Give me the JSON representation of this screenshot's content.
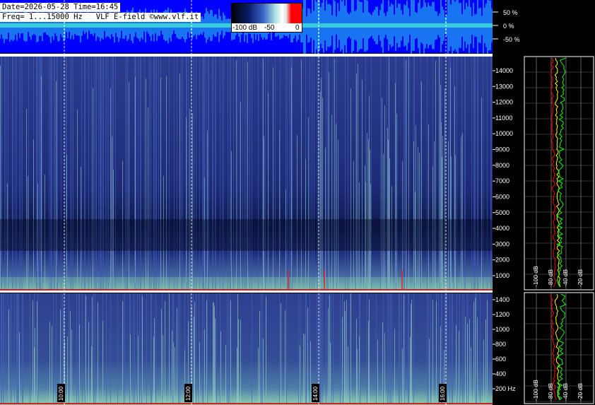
{
  "header": {
    "line1": "Date=2026-05-28 Time=16:45",
    "line2": "Freq= 1...15000 Hz   VLF E-field ©www.vlf.it"
  },
  "colorbar": {
    "labels": [
      "-100 dB",
      "-50",
      "0"
    ],
    "colors": [
      "#000000",
      "#0a1f6e",
      "#3a64c8",
      "#a8e0e0",
      "#ffffff",
      "#ff0000"
    ]
  },
  "chart_data": [
    {
      "type": "area",
      "name": "waveform-amplitude",
      "yaxis_ticks": [
        "50 %",
        "0 %",
        "-50 %"
      ],
      "ylim": [
        -100,
        100
      ]
    },
    {
      "type": "heatmap",
      "name": "spectrogram-wide",
      "yaxis_ticks": [
        "1000",
        "2000",
        "3000",
        "4000",
        "5000",
        "6000",
        "7000",
        "8000",
        "9000",
        "10000",
        "11000",
        "12000",
        "13000",
        "14000"
      ],
      "ylim": [
        0,
        15000
      ]
    },
    {
      "type": "heatmap",
      "name": "spectrogram-zoom",
      "yaxis_ticks": [
        "200 Hz",
        "400",
        "600",
        "800",
        "1000",
        "1200",
        "1400"
      ],
      "ylim": [
        0,
        1500
      ]
    },
    {
      "type": "line",
      "name": "spectrum-profile",
      "xaxis_ticks": [
        "-100 dB",
        "-80 dB",
        "-40 dB",
        "-20 dB"
      ],
      "series_colors": [
        "#ff0000",
        "#ffff00",
        "#00ff00",
        "#ffffff"
      ]
    }
  ],
  "time_axis": {
    "labels": [
      "10:00",
      "12:00",
      "14:00",
      "16:00"
    ]
  }
}
